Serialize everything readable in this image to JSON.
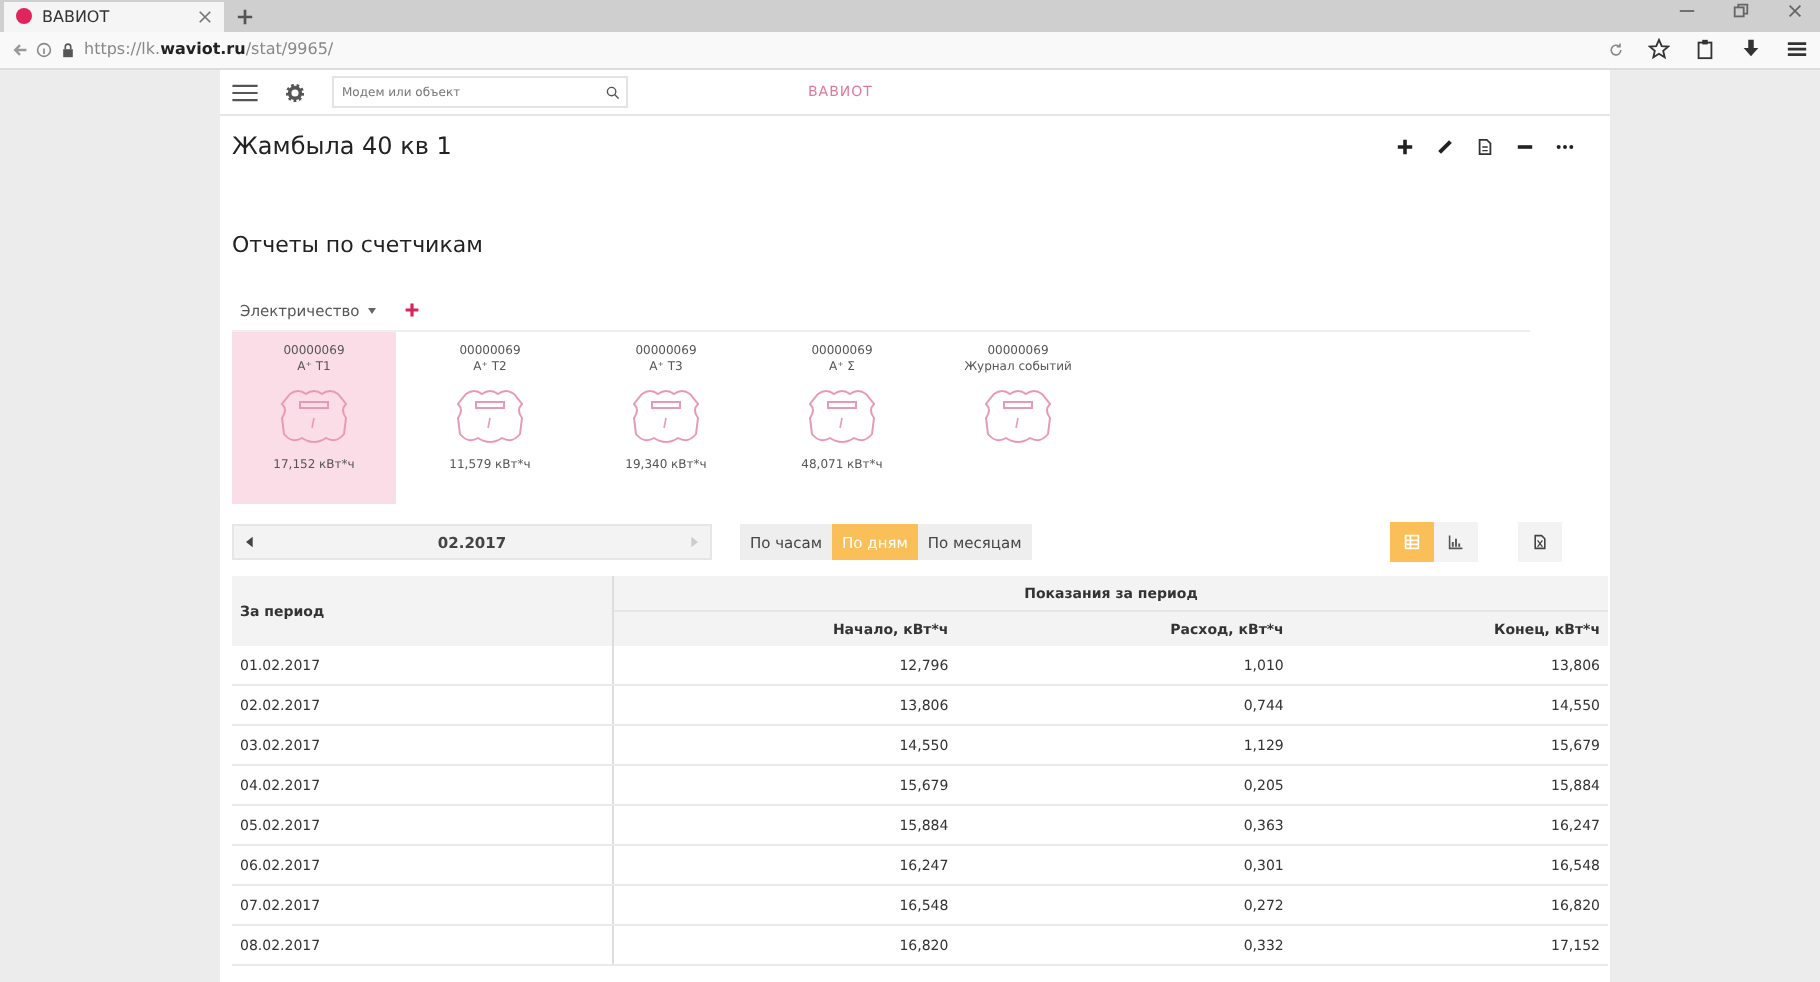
{
  "browser": {
    "tab_title": "ВАВИОТ",
    "url_prefix": "https://lk.",
    "url_domain": "waviot.ru",
    "url_path": "/stat/9965/"
  },
  "topbar": {
    "search_placeholder": "Модем или объект",
    "logo": "ВАВИОТ"
  },
  "object_title": "Жамбыла 40 кв 1",
  "section_title": "Отчеты по счетчикам",
  "resource_tab": {
    "label": "Электричество",
    "expanded": false
  },
  "meters": [
    {
      "serial": "00000069",
      "channel": "A⁺ T1",
      "reading": "17,152 кВт*ч",
      "selected": true
    },
    {
      "serial": "00000069",
      "channel": "A⁺ T2",
      "reading": "11,579 кВт*ч",
      "selected": false
    },
    {
      "serial": "00000069",
      "channel": "A⁺ T3",
      "reading": "19,340 кВт*ч",
      "selected": false
    },
    {
      "serial": "00000069",
      "channel": "A⁺ Σ",
      "reading": "48,071 кВт*ч",
      "selected": false
    },
    {
      "serial": "00000069",
      "channel": "Журнал событий",
      "selected": false
    }
  ],
  "period": {
    "value": "02.2017"
  },
  "granularity": [
    {
      "label": "По часам",
      "selected": false
    },
    {
      "label": "По дням",
      "selected": true
    },
    {
      "label": "По месяцам",
      "selected": false
    }
  ],
  "views": [
    {
      "kind": "table",
      "selected": true
    },
    {
      "kind": "chart",
      "selected": false
    }
  ],
  "table": {
    "column_group": "Показания за период",
    "columns": [
      "За период",
      "Начало, кВт*ч",
      "Расход, кВт*ч",
      "Конец, кВт*ч"
    ],
    "rows": [
      [
        "01.02.2017",
        "12,796",
        "1,010",
        "13,806"
      ],
      [
        "02.02.2017",
        "13,806",
        "0,744",
        "14,550"
      ],
      [
        "03.02.2017",
        "14,550",
        "1,129",
        "15,679"
      ],
      [
        "04.02.2017",
        "15,679",
        "0,205",
        "15,884"
      ],
      [
        "05.02.2017",
        "15,884",
        "0,363",
        "16,247"
      ],
      [
        "06.02.2017",
        "16,247",
        "0,301",
        "16,548"
      ],
      [
        "07.02.2017",
        "16,548",
        "0,272",
        "16,820"
      ],
      [
        "08.02.2017",
        "16,820",
        "0,332",
        "17,152"
      ]
    ]
  }
}
